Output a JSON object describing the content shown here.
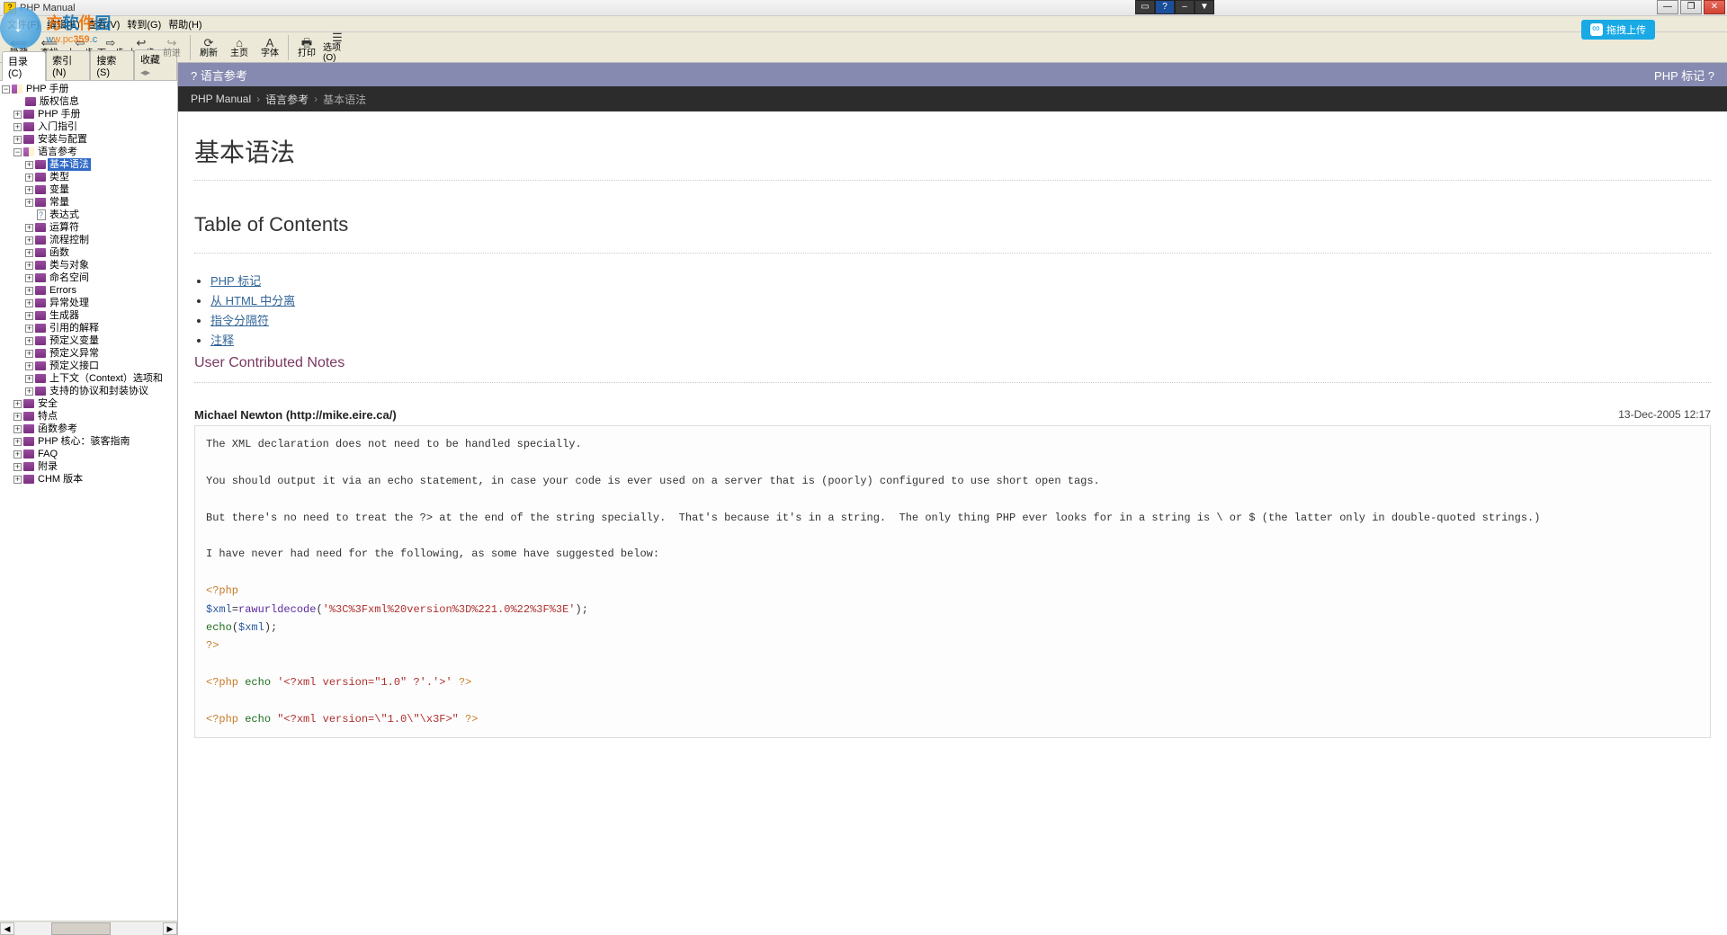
{
  "window": {
    "title": "PHP Manual"
  },
  "watermark": {
    "cn_chars": [
      "方",
      "软",
      "件",
      "园"
    ],
    "url_prefix": "w",
    "url_mid": "w.pc",
    "url_highlight": "359",
    "url_suffix": ".c"
  },
  "menubar": [
    "文件(F)",
    "编辑(E)",
    "查看(V)",
    "转到(G)",
    "帮助(H)"
  ],
  "toolbar": [
    {
      "icon": "⟸",
      "label": "隐藏",
      "id": "hide"
    },
    {
      "icon": "⟸",
      "label": "查找",
      "id": "find",
      "sepAfter": false
    },
    {
      "icon": "⇦",
      "label": "上一步",
      "id": "back"
    },
    {
      "icon": "⇨",
      "label": "下一步",
      "id": "fwd"
    },
    {
      "icon": "↩",
      "label": "上一步",
      "id": "prev"
    },
    {
      "icon": "↪",
      "label": "前进",
      "id": "next",
      "disabled": true,
      "sepAfter": true
    },
    {
      "icon": "⟳",
      "label": "刷新",
      "id": "refresh"
    },
    {
      "icon": "⌂",
      "label": "主页",
      "id": "home"
    },
    {
      "icon": "A",
      "label": "字体",
      "id": "font",
      "sepAfter": true
    },
    {
      "icon": "🖶",
      "label": "打印",
      "id": "print"
    },
    {
      "icon": "☰",
      "label": "选项(O)",
      "id": "options"
    }
  ],
  "upload_badge": "拖拽上传",
  "side_tabs": [
    "目录(C)",
    "索引(N)",
    "搜索(S)",
    "收藏"
  ],
  "tree": {
    "root": "PHP 手册",
    "top": [
      {
        "l": "版权信息",
        "i": "book-closed"
      },
      {
        "l": "PHP 手册",
        "i": "book-closed",
        "exp": true
      },
      {
        "l": "入门指引",
        "i": "book-closed",
        "exp": true
      },
      {
        "l": "安装与配置",
        "i": "book-closed",
        "exp": true
      }
    ],
    "langref": "语言参考",
    "langref_children": [
      {
        "l": "基本语法",
        "sel": true,
        "exp": true
      },
      {
        "l": "类型",
        "exp": true
      },
      {
        "l": "变量",
        "exp": true
      },
      {
        "l": "常量",
        "exp": true
      },
      {
        "l": "表达式",
        "i": "page"
      },
      {
        "l": "运算符",
        "exp": true
      },
      {
        "l": "流程控制",
        "exp": true
      },
      {
        "l": "函数",
        "exp": true
      },
      {
        "l": "类与对象",
        "exp": true
      },
      {
        "l": "命名空间",
        "exp": true
      },
      {
        "l": "Errors",
        "exp": true
      },
      {
        "l": "异常处理",
        "exp": true
      },
      {
        "l": "生成器",
        "exp": true
      },
      {
        "l": "引用的解释",
        "exp": true
      },
      {
        "l": "预定义变量",
        "exp": true
      },
      {
        "l": "预定义异常",
        "exp": true
      },
      {
        "l": "预定义接口",
        "exp": true
      },
      {
        "l": "上下文（Context）选项和",
        "exp": true
      },
      {
        "l": "支持的协议和封装协议",
        "exp": true
      }
    ],
    "after": [
      {
        "l": "安全",
        "exp": true
      },
      {
        "l": "特点",
        "exp": true
      },
      {
        "l": "函数参考",
        "exp": true
      },
      {
        "l": "PHP 核心：骇客指南",
        "exp": true
      },
      {
        "l": "FAQ",
        "exp": true
      },
      {
        "l": "附录",
        "exp": true
      },
      {
        "l": "CHM 版本",
        "exp": true
      }
    ]
  },
  "prevnext": {
    "prev": "? 语言参考",
    "next": "PHP 标记 ?"
  },
  "breadcrumb": [
    "PHP Manual",
    "语言参考",
    "基本语法"
  ],
  "article": {
    "h1": "基本语法",
    "toc_title": "Table of Contents",
    "toc": [
      "PHP 标记",
      "从 HTML 中分离",
      "指令分隔符",
      "注释"
    ],
    "ucn_title": "User Contributed Notes",
    "note": {
      "author": "Michael Newton (http://mike.eire.ca/)",
      "date": "13-Dec-2005 12:17",
      "p1": "The XML declaration does not need to be handled specially.",
      "p2": "You should output it via an echo statement, in case your code is ever used on a server that is (poorly) configured to use short open tags.",
      "p3": "But there's no need to treat the ?> at the end of the string specially.  That's because it's in a string.  The only thing PHP ever looks for in a string is \\ or $ (the latter only in double-quoted strings.)",
      "p4": "I have never had need for the following, as some have suggested below:",
      "code_rawurl_arg": "'%3C%3Fxml%20version%3D%221.0%22%3F%3E'",
      "code_echo1_str": "'<?xml version=\"1.0\" ?'.'>'",
      "code_echo2_str": "\"<?xml version=\\\"1.0\\\"\\x3F>\""
    }
  }
}
